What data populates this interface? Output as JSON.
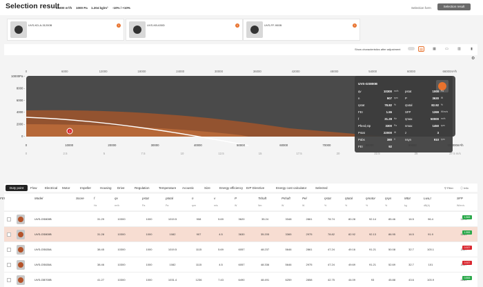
{
  "header": {
    "title": "Selection result",
    "flow": "10300 m³/h",
    "pressure": "1000 Pa",
    "density": "1.204 kg/m³",
    "tolerance": "-10% / +10%",
    "selection_form_label": "Selection form",
    "selection_result_button": "Selection result"
  },
  "compare_cards": [
    {
      "label": "UVS-KD-A-31200B",
      "badge": "1"
    },
    {
      "label": "UVS-KB-630D",
      "badge": "1"
    },
    {
      "label": "UVS-FF-900B",
      "badge": "1"
    }
  ],
  "controls": {
    "show_adjustment_label": "Show characteristics after adjustment"
  },
  "chart": {
    "top_ticks": [
      "0",
      "6000",
      "12000",
      "18000",
      "24000",
      "30000",
      "36000",
      "42000",
      "48000",
      "54000",
      "60000",
      "66000m³/h"
    ],
    "y_ticks": [
      "10000Pa -",
      "8000 -",
      "6000 -",
      "4000 -",
      "2000 -",
      "0 -"
    ],
    "x_ticks": [
      "0",
      "10000",
      "20000",
      "30000",
      "40000",
      "50000",
      "60000",
      "70000",
      "80000",
      "90000",
      "100000m³/h"
    ],
    "x2_ticks": [
      "0",
      "2.5",
      "5",
      "7.5",
      "10",
      "12.5",
      "15",
      "17.5",
      "20",
      "22.5",
      "25",
      "27.5 m/s"
    ],
    "marker": "1"
  },
  "tooltip": {
    "title": "UVS-GS800B",
    "left": [
      {
        "k": "qv",
        "v": "10300",
        "u": "m³/h"
      },
      {
        "k": "n",
        "v": "907",
        "u": "rpm"
      },
      {
        "k": "ηstat",
        "v": "78.82",
        "u": "%"
      },
      {
        "k": "FEI",
        "v": "1.55",
        "u": ""
      },
      {
        "k": "f",
        "v": "31.28",
        "u": "Hz"
      },
      {
        "k": "Pfeed,stp",
        "v": "3300",
        "u": "Pa"
      },
      {
        "k": "Pstat",
        "v": "22000",
        "u": "W"
      },
      {
        "k": "Pabs",
        "v": "380",
        "u": "V"
      },
      {
        "k": "FEI",
        "v": "92",
        "u": ""
      }
    ],
    "right": [
      {
        "k": "pstat",
        "v": "1000",
        "u": "Pa"
      },
      {
        "k": "P",
        "v": "3630",
        "u": "W"
      },
      {
        "k": "ηtotal",
        "v": "82.92",
        "u": "%"
      },
      {
        "k": "SFP",
        "v": "1269",
        "u": "W/m³/s"
      },
      {
        "k": "ηmax",
        "v": "50000",
        "u": "m³/h"
      },
      {
        "k": "nmax",
        "v": "1450",
        "u": "rpm"
      },
      {
        "k": "z",
        "v": "3",
        "u": ""
      },
      {
        "k": "nsyn",
        "v": "910",
        "u": "rpm"
      }
    ]
  },
  "tabs": {
    "duty_point": "Duty point",
    "items": [
      "Flow",
      "Electrical",
      "Motor",
      "Impeller",
      "Housing",
      "Drive",
      "Regulation",
      "Temperature",
      "Acoustic",
      "Size",
      "Energy efficiency",
      "ErP Directive",
      "Energy cost calculator",
      "Selected"
    ],
    "filter": "Filter",
    "info": "Info"
  },
  "table": {
    "headers": [
      "Model",
      "Score",
      "f",
      "qv",
      "pstat",
      "ptotal",
      "n",
      "v",
      "P",
      "Tshaft",
      "Pshaft",
      "Pel",
      "ηstat",
      "ηtotal",
      "ηmotor",
      "ηsys",
      "Mtot",
      "Lwa,t",
      "SFP",
      "FEI"
    ],
    "units": [
      "",
      "",
      "Hz",
      "m³/h",
      "Pa",
      "Pa",
      "rpm",
      "m/s",
      "W",
      "Nm",
      "W",
      "W",
      "%",
      "%",
      "%",
      "%",
      "kg",
      "dB(A)",
      "W/m³/s",
      ""
    ],
    "rows": [
      {
        "model": "UVS-GS800B",
        "c": [
          "",
          "31.29",
          "10300",
          "1000",
          "1019.5",
          "908",
          "5.69",
          "3620",
          "35.24",
          "3348",
          "2861",
          "78.74",
          "80.28",
          "92.14",
          "85.46",
          "16.5",
          "96.4",
          "1270"
        ],
        "fei": "1.563",
        "fei_color": "#2aa84a"
      },
      {
        "model": "UVS-GS800B",
        "c": [
          "",
          "31.28",
          "10300",
          "1000",
          "1082",
          "907",
          "4.5",
          "3630",
          "35.205",
          "3365",
          "2975",
          "78.82",
          "82.92",
          "92.13",
          "86.95",
          "16.5",
          "91.9",
          "1269"
        ],
        "fei": "1.553",
        "fei_color": "#2aa84a",
        "hl": true
      },
      {
        "model": "UVS-GS630A",
        "c": [
          "",
          "38.45",
          "10300",
          "1000",
          "1019.5",
          "1115",
          "5.69",
          "6057",
          "48.237",
          "5646",
          "2861",
          "47.24",
          "49.16",
          "91.21",
          "50.08",
          "32.7",
          "103.1",
          "2117"
        ],
        "fei": "0.927",
        "fei_color": "#d9262e"
      },
      {
        "model": "UVS-GS630A",
        "c": [
          "",
          "38.46",
          "10300",
          "1000",
          "1082",
          "1115",
          "4.5",
          "6057",
          "48.336",
          "5646",
          "2975",
          "47.24",
          "49.69",
          "91.21",
          "52.69",
          "32.7",
          "101",
          "2117"
        ],
        "fei": "0.927",
        "fei_color": "#d9262e"
      },
      {
        "model": "UVS-GB700B",
        "c": [
          "",
          "41.27",
          "10300",
          "1000",
          "1031.4",
          "1236",
          "7.43",
          "6490",
          "48.491",
          "6259",
          "2858",
          "42.75",
          "44.09",
          "93",
          "45.88",
          "43.6",
          "103.9",
          "2269"
        ],
        "fei": "0.853",
        "fei_color": "#2aa84a"
      }
    ]
  }
}
